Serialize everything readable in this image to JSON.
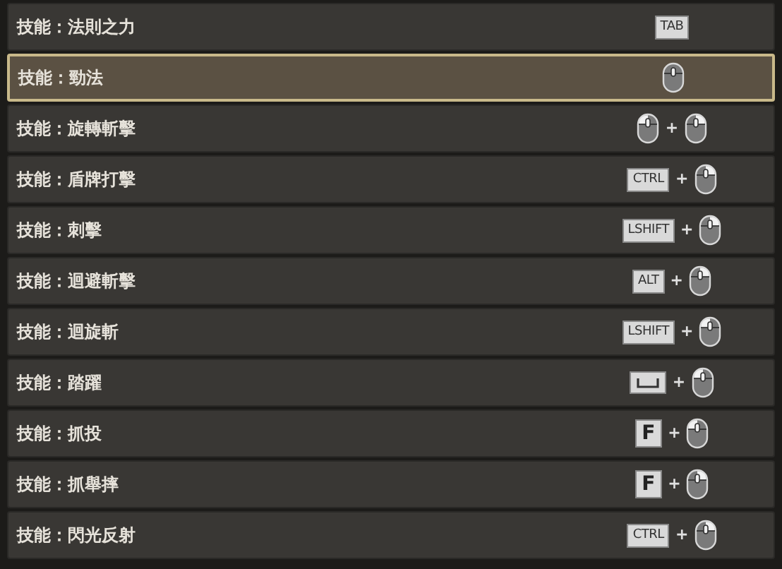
{
  "rows": [
    {
      "label": "技能：法則之力",
      "selected": false,
      "keys": [
        {
          "kind": "key",
          "text": "TAB"
        }
      ]
    },
    {
      "label": "技能：勁法",
      "selected": true,
      "keys": [
        {
          "kind": "mouse"
        }
      ]
    },
    {
      "label": "技能：旋轉斬擊",
      "selected": false,
      "keys": [
        {
          "kind": "leftclick"
        },
        {
          "kind": "plus",
          "text": "+"
        },
        {
          "kind": "rightclick"
        }
      ]
    },
    {
      "label": "技能：盾牌打擊",
      "selected": false,
      "keys": [
        {
          "kind": "key",
          "text": "CTRL"
        },
        {
          "kind": "plus",
          "text": "+"
        },
        {
          "kind": "rightclick"
        }
      ]
    },
    {
      "label": "技能：刺擊",
      "selected": false,
      "keys": [
        {
          "kind": "key",
          "text": "LSHIFT"
        },
        {
          "kind": "plus",
          "text": "+"
        },
        {
          "kind": "rightclick"
        }
      ]
    },
    {
      "label": "技能：迴避斬擊",
      "selected": false,
      "keys": [
        {
          "kind": "key",
          "text": "ALT"
        },
        {
          "kind": "plus",
          "text": "+"
        },
        {
          "kind": "rightclick"
        }
      ]
    },
    {
      "label": "技能：迴旋斬",
      "selected": false,
      "keys": [
        {
          "kind": "key",
          "text": "LSHIFT"
        },
        {
          "kind": "plus",
          "text": "+"
        },
        {
          "kind": "leftclick"
        }
      ]
    },
    {
      "label": "技能：踏躍",
      "selected": false,
      "keys": [
        {
          "kind": "space"
        },
        {
          "kind": "plus",
          "text": "+"
        },
        {
          "kind": "leftclick"
        }
      ]
    },
    {
      "label": "技能：抓投",
      "selected": false,
      "keys": [
        {
          "kind": "bigkey",
          "text": "F"
        },
        {
          "kind": "plus",
          "text": "+"
        },
        {
          "kind": "leftclick"
        }
      ]
    },
    {
      "label": "技能：抓舉摔",
      "selected": false,
      "keys": [
        {
          "kind": "bigkey",
          "text": "F"
        },
        {
          "kind": "plus",
          "text": "+"
        },
        {
          "kind": "rightclick"
        }
      ]
    },
    {
      "label": "技能：閃光反射",
      "selected": false,
      "keys": [
        {
          "kind": "key",
          "text": "CTRL"
        },
        {
          "kind": "plus",
          "text": "+"
        },
        {
          "kind": "rightclick"
        }
      ]
    }
  ]
}
